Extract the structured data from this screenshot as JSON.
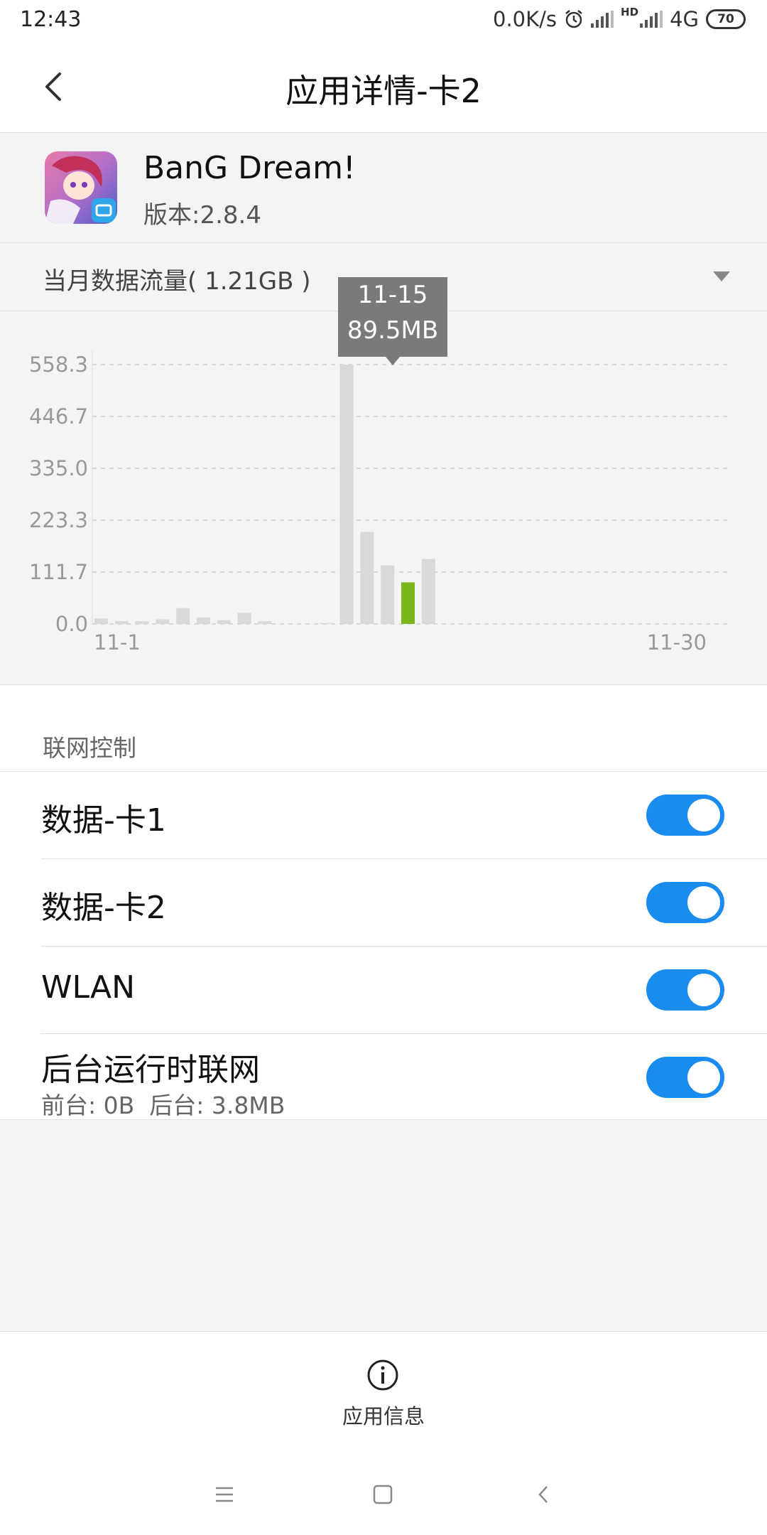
{
  "status_bar": {
    "time": "12:43",
    "net_speed": "0.0K/s",
    "network_type": "4G",
    "hd_badge": "HD",
    "battery": "70",
    "icons": [
      "alarm-icon",
      "signal-icon",
      "signal-hd-icon",
      "battery-icon"
    ]
  },
  "header": {
    "title": "应用详情-卡2",
    "back_icon": "chevron-left-icon"
  },
  "app": {
    "name": "BanG Dream!",
    "version": "版本:2.8.4"
  },
  "usage": {
    "label": "当月数据流量( 1.21GB )",
    "dropdown_icon": "triangle-down-icon"
  },
  "tooltip": {
    "date": "11-15",
    "value": "89.5MB"
  },
  "chart_data": {
    "type": "bar",
    "x_start_label": "11-1",
    "x_end_label": "11-30",
    "y_ticks": [
      "0.0",
      "111.7",
      "223.3",
      "335.0",
      "446.7",
      "558.3"
    ],
    "ylim": [
      0,
      558.3
    ],
    "days": 30,
    "values": [
      12,
      6,
      6,
      10,
      34,
      14,
      8,
      24,
      6,
      0,
      0,
      2,
      558.3,
      198,
      126,
      89.5,
      140
    ],
    "highlight_index": 15,
    "bar_color": "#d9d9d9",
    "highlight_color": "#7cb518",
    "grid": true
  },
  "network_control": {
    "title": "联网控制",
    "items": [
      {
        "label": "数据-卡1",
        "enabled": true
      },
      {
        "label": "数据-卡2",
        "enabled": true
      },
      {
        "label": "WLAN",
        "enabled": true
      },
      {
        "label": "后台运行时联网",
        "sub": "前台: 0B  后台: 3.8MB",
        "enabled": true
      }
    ],
    "toggle_color": "#1a8cf0"
  },
  "bottom": {
    "app_info_label": "应用信息",
    "app_info_icon": "info-circle-icon"
  },
  "navbar": {
    "icons": [
      "menu-icon",
      "home-square-icon",
      "back-chevron-icon"
    ]
  }
}
